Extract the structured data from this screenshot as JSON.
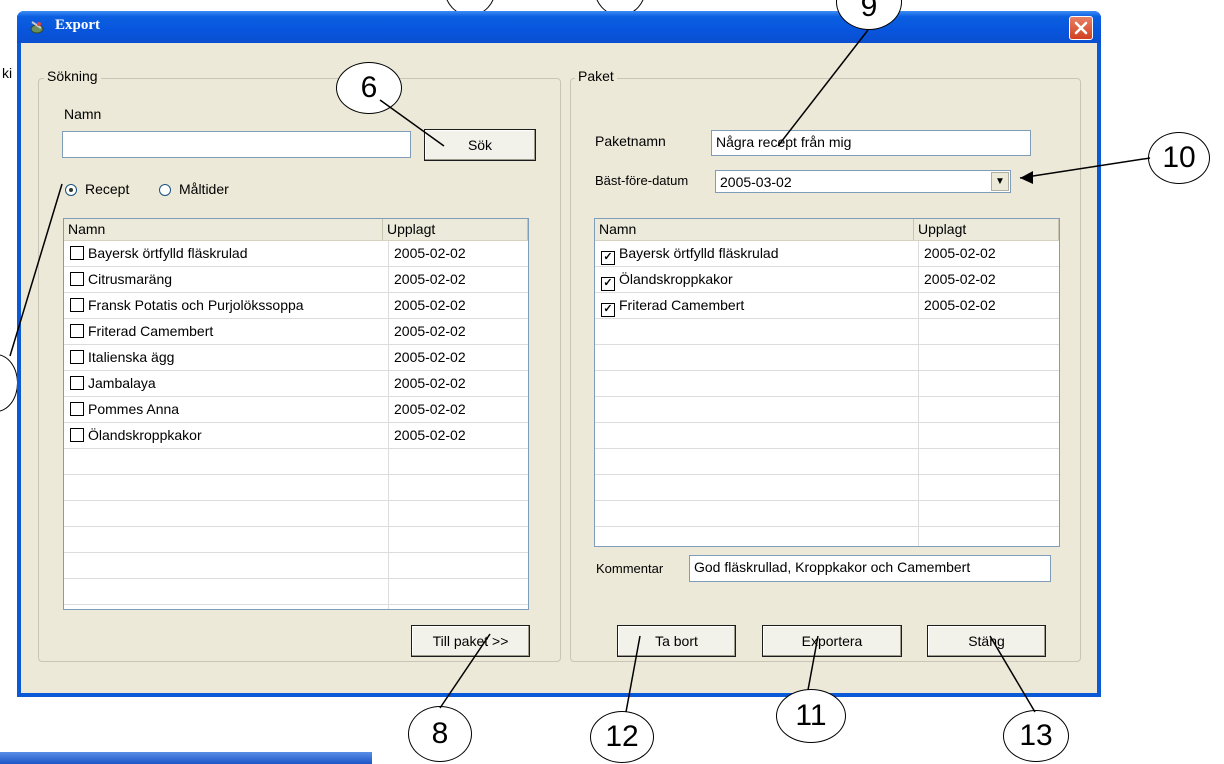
{
  "window": {
    "title": "Export",
    "icons": {
      "title": "recipe-app-icon",
      "close": "close-icon"
    }
  },
  "left_fragment": "ki",
  "search_group": {
    "legend": "Sökning",
    "name_label": "Namn",
    "name_value": "",
    "search_button": "Sök",
    "radio": [
      {
        "label": "Recept",
        "selected": true
      },
      {
        "label": "Måltider",
        "selected": false
      }
    ],
    "columns": [
      "Namn",
      "Upplagt"
    ],
    "rows": [
      {
        "name": "Bayersk örtfylld fläskrulad",
        "date": "2005-02-02",
        "checked": false
      },
      {
        "name": "Citrusmaräng",
        "date": "2005-02-02",
        "checked": false
      },
      {
        "name": "Fransk Potatis och Purjolökssoppa",
        "date": "2005-02-02",
        "checked": false
      },
      {
        "name": "Friterad Camembert",
        "date": "2005-02-02",
        "checked": false
      },
      {
        "name": "Italienska ägg",
        "date": "2005-02-02",
        "checked": false
      },
      {
        "name": "Jambalaya",
        "date": "2005-02-02",
        "checked": false
      },
      {
        "name": "Pommes Anna",
        "date": "2005-02-02",
        "checked": false
      },
      {
        "name": "Ölandskroppkakor",
        "date": "2005-02-02",
        "checked": false
      }
    ],
    "to_package_button": "Till paket >>"
  },
  "package_group": {
    "legend": "Paket",
    "package_name_label": "Paketnamn",
    "package_name_value": "Några recept från mig",
    "best_before_label": "Bäst-före-datum",
    "best_before_value": "2005-03-02",
    "columns": [
      "Namn",
      "Upplagt"
    ],
    "rows": [
      {
        "name": "Bayersk örtfylld fläskrulad",
        "date": "2005-02-02",
        "checked": true
      },
      {
        "name": "Ölandskroppkakor",
        "date": "2005-02-02",
        "checked": true
      },
      {
        "name": "Friterad Camembert",
        "date": "2005-02-02",
        "checked": true
      }
    ],
    "comment_label": "Kommentar",
    "comment_value": "God fläskrullad, Kroppkakor och Camembert",
    "remove_button": "Ta bort",
    "export_button": "Exportera",
    "close_button": "Stäng"
  },
  "callouts": {
    "c6": "6",
    "c9": "9",
    "c10": "10",
    "c8": "8",
    "c12": "12",
    "c11": "11",
    "c13": "13"
  }
}
